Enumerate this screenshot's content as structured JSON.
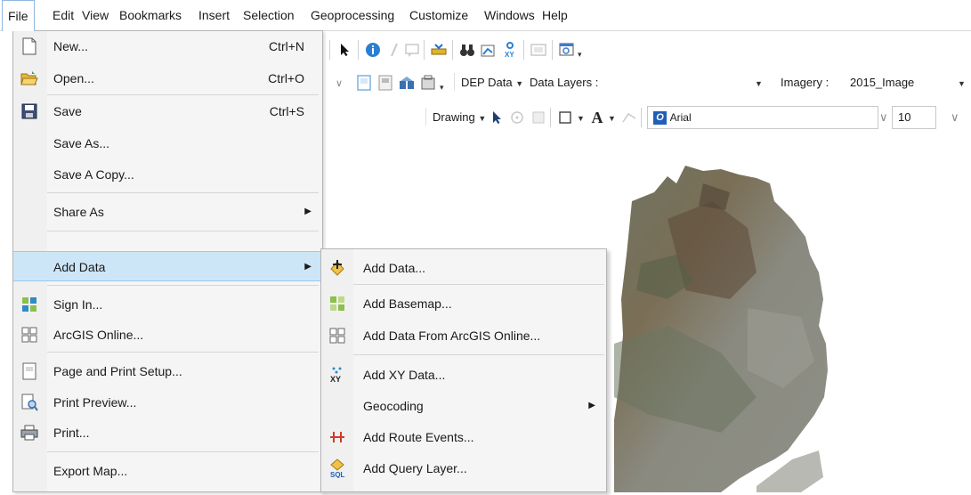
{
  "menubar": {
    "items": [
      "File",
      "Edit",
      "View",
      "Bookmarks",
      "Insert",
      "Selection",
      "Geoprocessing",
      "Customize",
      "Windows",
      "Help"
    ]
  },
  "toolbar": {
    "dep_data_label": "DEP Data",
    "data_layers_label": "Data Layers :",
    "imagery_label": "Imagery :",
    "imagery_value": "2015_Image",
    "drawing_label": "Drawing",
    "font_name": "Arial",
    "font_size": "10"
  },
  "file_menu": {
    "items": [
      {
        "label": "New...",
        "shortcut": "Ctrl+N",
        "icon": "new-document-icon"
      },
      {
        "label": "Open...",
        "shortcut": "Ctrl+O",
        "icon": "open-folder-icon"
      },
      {
        "label": "Save",
        "shortcut": "Ctrl+S",
        "icon": "save-disk-icon"
      },
      {
        "label": "Save As...",
        "shortcut": "",
        "icon": ""
      },
      {
        "label": "Save A Copy...",
        "shortcut": "",
        "icon": ""
      },
      {
        "label": "Share As",
        "shortcut": "",
        "icon": "",
        "submenu": true
      },
      {
        "label": "Add Data",
        "shortcut": "",
        "icon": "",
        "submenu": true,
        "highlighted": true
      },
      {
        "label": "Sign In...",
        "shortcut": "",
        "icon": "sign-in-icon"
      },
      {
        "label": "ArcGIS Online...",
        "shortcut": "",
        "icon": "arcgis-online-icon"
      },
      {
        "label": "Page and Print Setup...",
        "shortcut": "",
        "icon": "page-setup-icon"
      },
      {
        "label": "Print Preview...",
        "shortcut": "",
        "icon": "print-preview-icon"
      },
      {
        "label": "Print...",
        "shortcut": "",
        "icon": "printer-icon"
      },
      {
        "label": "Export Map...",
        "shortcut": "",
        "icon": ""
      }
    ]
  },
  "add_data_submenu": {
    "items": [
      {
        "label": "Add Data...",
        "icon": "add-data-icon"
      },
      {
        "label": "Add Basemap...",
        "icon": "add-basemap-icon"
      },
      {
        "label": "Add Data From ArcGIS Online...",
        "icon": "arcgis-online-grid-icon"
      },
      {
        "label": "Add XY Data...",
        "icon": "xy-data-icon"
      },
      {
        "label": "Geocoding",
        "icon": "",
        "submenu": true
      },
      {
        "label": "Add Route Events...",
        "icon": "route-events-icon"
      },
      {
        "label": "Add Query Layer...",
        "icon": "sql-query-icon"
      }
    ]
  },
  "colors": {
    "highlight": "#cde6f7",
    "highlight_border": "#99c9ef",
    "menu_bg": "#f5f5f5"
  }
}
